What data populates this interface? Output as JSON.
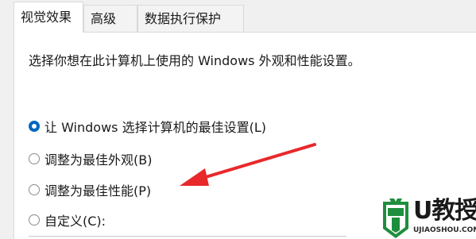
{
  "tabs": [
    {
      "label": "视觉效果",
      "active": true
    },
    {
      "label": "高级",
      "active": false
    },
    {
      "label": "数据执行保护",
      "active": false
    }
  ],
  "description": "选择你想在此计算机上使用的 Windows 外观和性能设置。",
  "options": [
    {
      "label": "让 Windows 选择计算机的最佳设置(L)",
      "checked": true
    },
    {
      "label": "调整为最佳外观(B)",
      "checked": false
    },
    {
      "label": "调整为最佳性能(P)",
      "checked": false
    },
    {
      "label": "自定义(C):",
      "checked": false
    }
  ],
  "colors": {
    "accent": "#0067c0",
    "arrow": "#e8282b",
    "logo_green": "#1e8e3e"
  },
  "watermark": {
    "brand": "U教授",
    "url": "UJIAOSHOU.COM"
  }
}
